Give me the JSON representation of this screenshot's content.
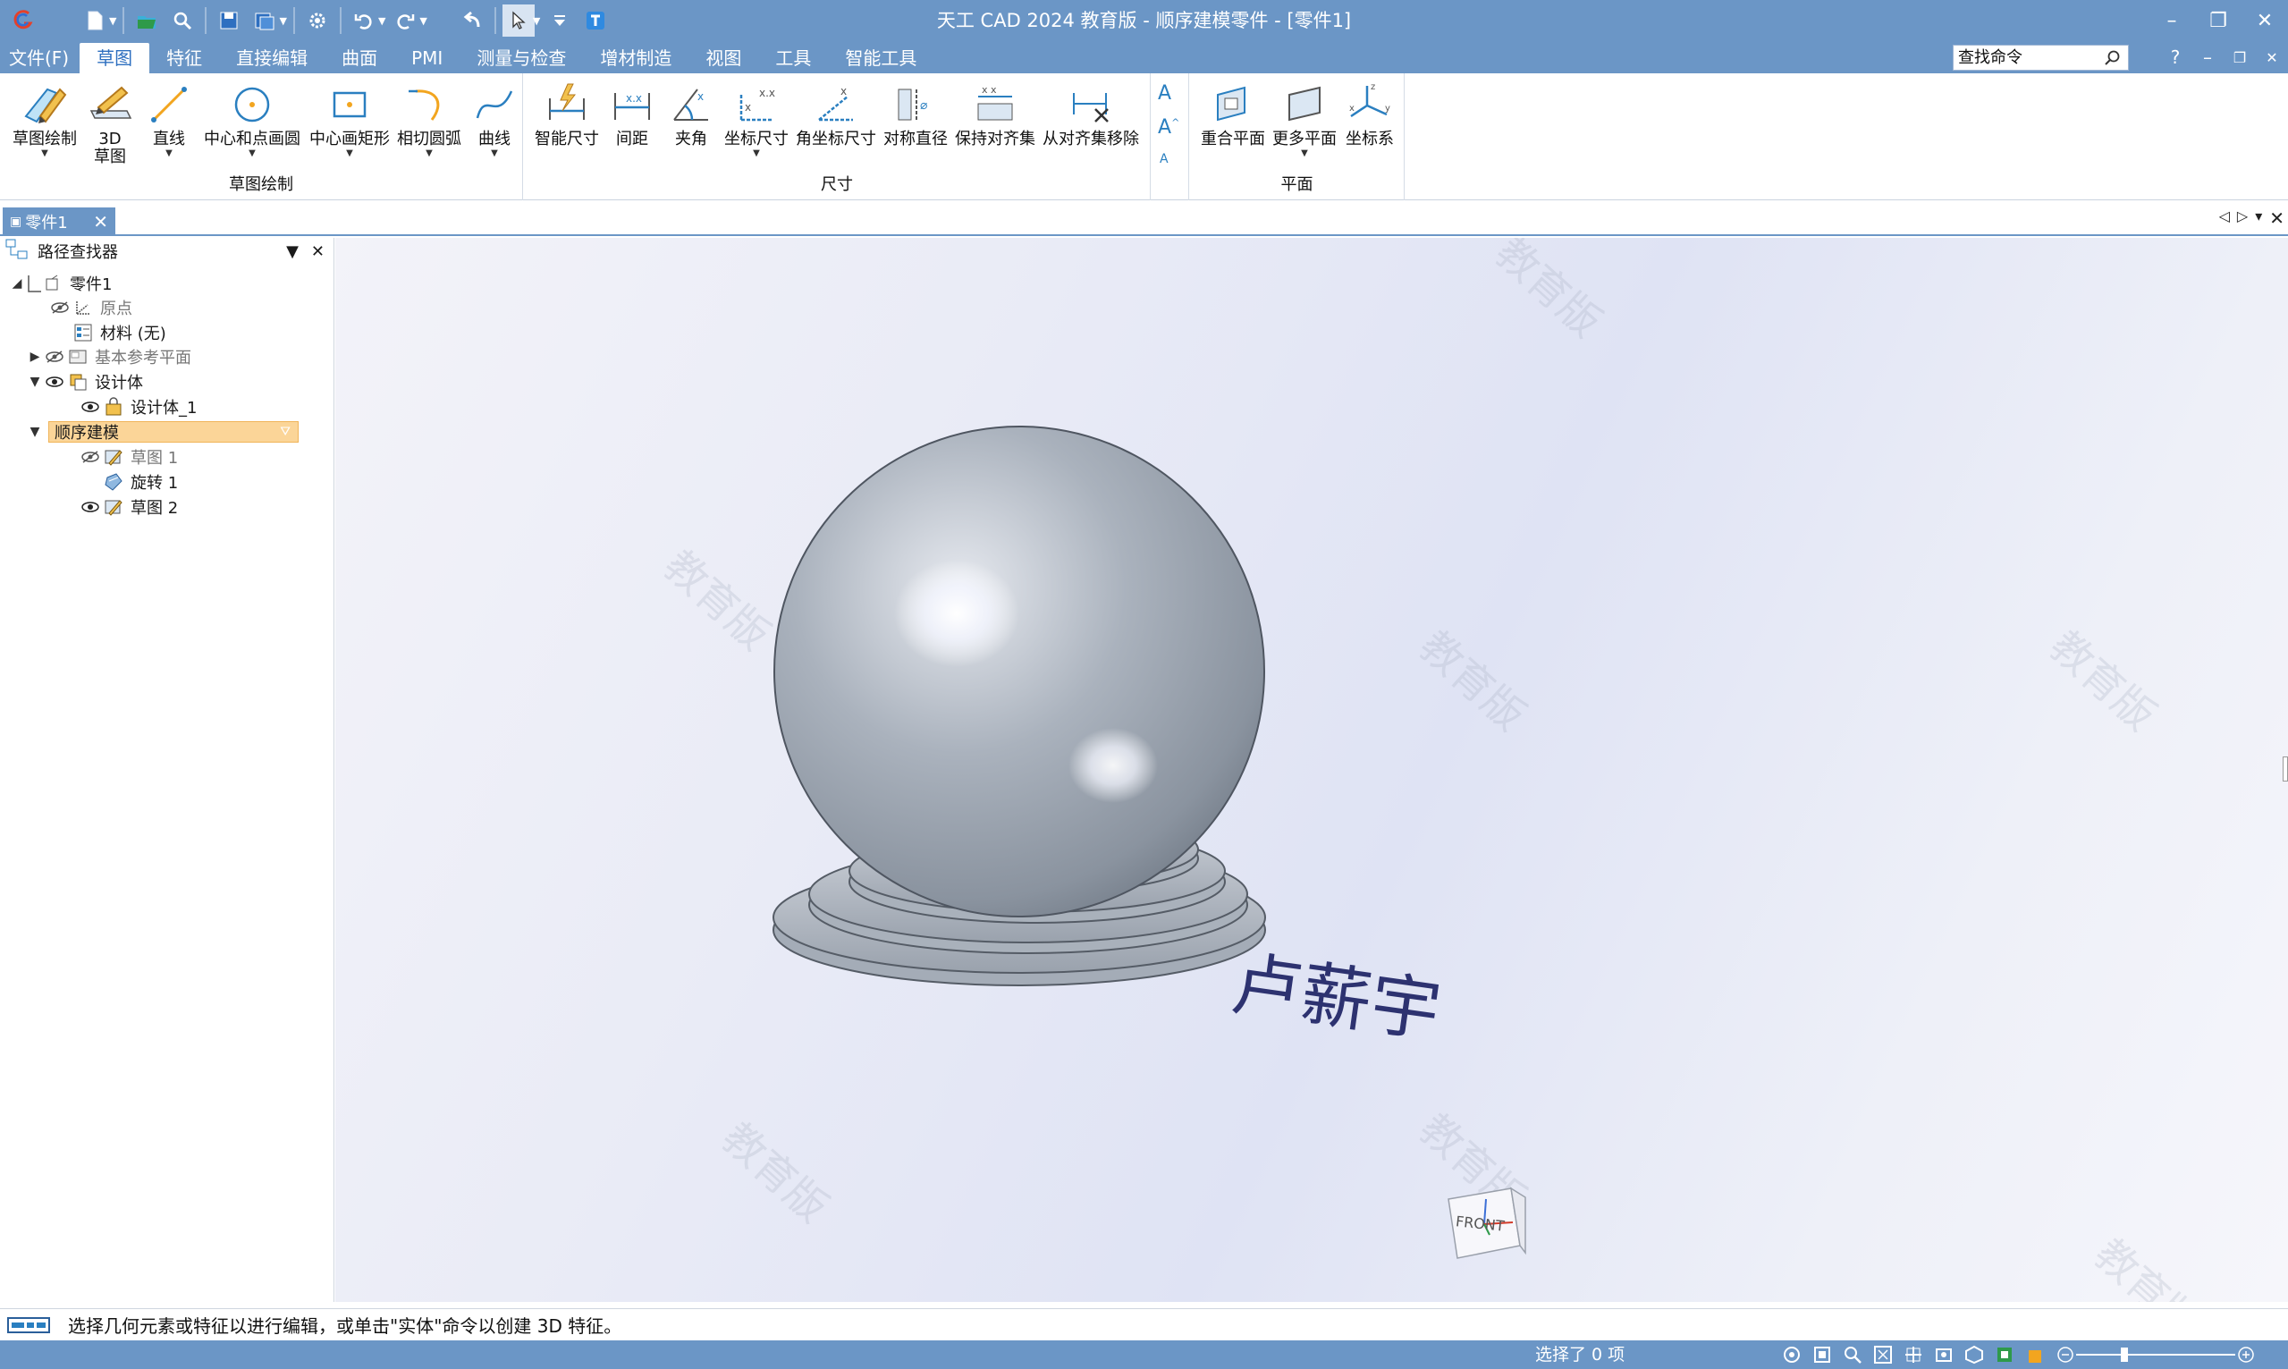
{
  "title": "天工 CAD 2024 教育版 - 顺序建模零件 - [零件1]",
  "menu": {
    "file": "文件(F)",
    "tabs": [
      "草图",
      "特征",
      "直接编辑",
      "曲面",
      "PMI",
      "测量与检查",
      "增材制造",
      "视图",
      "工具",
      "智能工具"
    ],
    "active_tab": "草图",
    "search_placeholder": "查找命令",
    "help": "?"
  },
  "ribbon": {
    "sketch_group": {
      "label": "草图绘制",
      "buttons": [
        "草图绘制",
        "3D\n草图",
        "直线",
        "中心和点画圆",
        "中心画矩形",
        "相切圆弧",
        "曲线"
      ]
    },
    "dim_group": {
      "label": "尺寸",
      "buttons": [
        "智能尺寸",
        "间距",
        "夹角",
        "坐标尺寸",
        "角坐标尺寸",
        "对称直径",
        "保持对齐集",
        "从对齐集移除"
      ]
    },
    "plane_group": {
      "label": "平面",
      "buttons": [
        "重合平面",
        "更多平面",
        "坐标系"
      ]
    }
  },
  "doc_tab": {
    "label": "零件1"
  },
  "pathfinder": {
    "title": "路径查找器",
    "nodes": {
      "part": "零件1",
      "origin": "原点",
      "material": "材料 (无)",
      "ref_planes": "基本参考平面",
      "design_body": "设计体",
      "design_body_1": "设计体_1",
      "seq_modeling": "顺序建模",
      "sketch1": "草图 1",
      "revolve1": "旋转 1",
      "sketch2": "草图 2"
    }
  },
  "viewport": {
    "name_text": "卢薪宇",
    "watermark": "教育版",
    "view_cube_label": "FRONT"
  },
  "status": {
    "prompt": "选择几何元素或特征以进行编辑，或单击\"实体\"命令以创建 3D 特征。",
    "selection": "选择了 0 项"
  },
  "colors": {
    "titlebar": "#6b96c6",
    "accent": "#2e6fc0",
    "highlight": "#fbd598"
  }
}
